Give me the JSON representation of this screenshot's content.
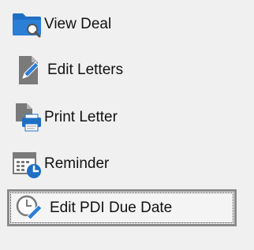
{
  "menu": {
    "items": [
      {
        "label": "View Deal",
        "icon": "folder-search-icon"
      },
      {
        "label": "Edit Letters",
        "icon": "edit-document-icon"
      },
      {
        "label": "Print Letter",
        "icon": "print-document-icon"
      },
      {
        "label": "Reminder",
        "icon": "calendar-clock-icon"
      },
      {
        "label": "Edit PDI Due Date",
        "icon": "clock-pencil-icon",
        "focused": true
      }
    ]
  },
  "colors": {
    "background": "#f0f0f0",
    "icon_blue": "#1f6fc5",
    "icon_gray": "#7a7a7a",
    "focus_border": "#8a8a8a"
  }
}
